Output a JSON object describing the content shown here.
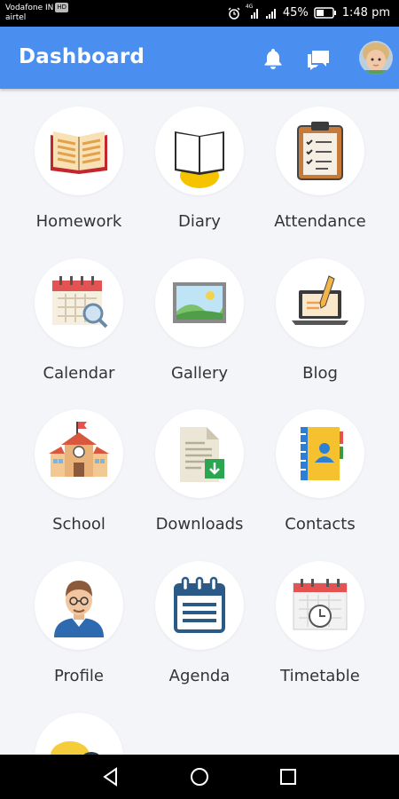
{
  "status_bar": {
    "carrier_line1": "Vodafone IN",
    "carrier_badge": "HD",
    "carrier_line2": "airtel",
    "network": "4G",
    "battery": "45%",
    "time": "1:48 pm"
  },
  "app_bar": {
    "title": "Dashboard",
    "icons": [
      "bell-icon",
      "chat-icon",
      "avatar"
    ]
  },
  "dashboard": {
    "items": [
      {
        "label": "Homework",
        "icon": "homework-book-icon"
      },
      {
        "label": "Diary",
        "icon": "diary-icon"
      },
      {
        "label": "Attendance",
        "icon": "attendance-clipboard-icon"
      },
      {
        "label": "Calendar",
        "icon": "calendar-icon"
      },
      {
        "label": "Gallery",
        "icon": "gallery-picture-icon"
      },
      {
        "label": "Blog",
        "icon": "blog-laptop-icon"
      },
      {
        "label": "School",
        "icon": "school-building-icon"
      },
      {
        "label": "Downloads",
        "icon": "downloads-document-icon"
      },
      {
        "label": "Contacts",
        "icon": "contacts-book-icon"
      },
      {
        "label": "Profile",
        "icon": "profile-person-icon"
      },
      {
        "label": "Agenda",
        "icon": "agenda-notepad-icon"
      },
      {
        "label": "Timetable",
        "icon": "timetable-calendar-clock-icon"
      }
    ]
  },
  "nav_bar": {
    "buttons": [
      "back-icon",
      "home-icon",
      "recents-icon"
    ]
  },
  "colors": {
    "primary": "#4a8ff0",
    "background": "#f4f5f8",
    "label": "#333333"
  }
}
